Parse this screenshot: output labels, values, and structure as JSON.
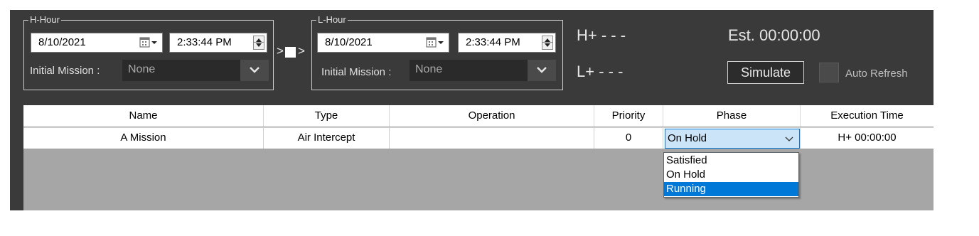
{
  "h_hour": {
    "title": "H-Hour",
    "date": "8/10/2021",
    "time": "2:33:44 PM",
    "mission_label": "Initial Mission :",
    "mission_value": "None"
  },
  "link": {
    "left": ">",
    "right": ">"
  },
  "l_hour": {
    "title": "L-Hour",
    "date": "8/10/2021",
    "time": "2:33:44 PM",
    "mission_label": "Initial Mission :",
    "mission_value": "None"
  },
  "status": {
    "h_plus": "H+ - - -",
    "l_plus": "L+ - - -",
    "est": "Est. 00:00:00"
  },
  "simulate_label": "Simulate",
  "auto_refresh_label": "Auto Refresh",
  "table": {
    "headers": [
      "Name",
      "Type",
      "Operation",
      "Priority",
      "Phase",
      "Execution Time"
    ],
    "rows": [
      {
        "name": "A Mission",
        "type": "Air Intercept",
        "operation": "",
        "priority": "0",
        "phase": "On Hold",
        "execution_time": "H+ 00:00:00"
      }
    ]
  },
  "phase_dropdown": {
    "options": [
      "Satisfied",
      "On Hold",
      "Running"
    ],
    "highlighted": "Running"
  },
  "colors": {
    "panel": "#3a3a3a",
    "grid_background": "#a6a6a6",
    "selection": "#0078d7",
    "combo_focus": "#cce4f7"
  }
}
